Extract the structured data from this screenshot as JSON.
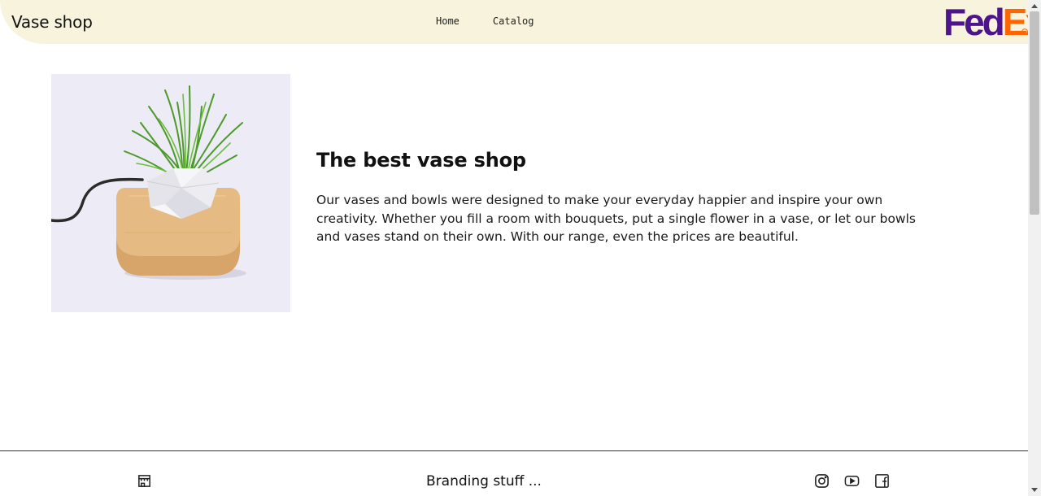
{
  "header": {
    "brand": "Vase shop",
    "nav": [
      {
        "label": "Home"
      },
      {
        "label": "Catalog"
      }
    ],
    "logo": {
      "part1": "Fed",
      "part2": "Ex",
      "color1": "#4d148c",
      "color2": "#ff6600"
    }
  },
  "hero": {
    "title": "The best vase shop",
    "text": "Our vases and bowls were designed to make your everyday happier and inspire your own creativity. Whether you fill a room with bouquets, put a single flower in a vase, or let our bowls and vases stand on their own. With our range, even the prices are beautiful."
  },
  "footer": {
    "branding": "Branding stuff ...",
    "icons": [
      "store-icon",
      "instagram-icon",
      "youtube-icon",
      "facebook-icon"
    ]
  },
  "colors": {
    "header_bg": "#f7f3dc",
    "footer_line": "#333333"
  }
}
